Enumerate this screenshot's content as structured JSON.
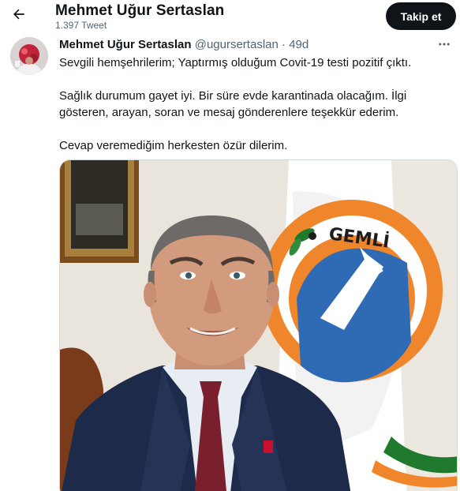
{
  "header": {
    "title": "Mehmet Uğur Sertaslan",
    "tweet_count": "1.397 Tweet",
    "follow_label": "Takip et",
    "back_icon": "arrow-left-icon"
  },
  "tweet": {
    "author_name": "Mehmet Uğur Sertaslan",
    "author_handle": "@ugursertaslan",
    "separator": "·",
    "time": "49d",
    "more_icon": "more-horizontal-icon",
    "paragraphs": [
      "Sevgili hemşehrilerim; Yaptırmış olduğum Covit-19 testi pozitif çıktı.",
      "Sağlık durumum gayet iyi. Bir süre evde karantinada olacağım. İlgi gösteren, arayan, soran ve mesaj gönderenlere teşekkür ederim.",
      "Cevap veremediğim herkesten özür dilerim."
    ],
    "media": {
      "logo_text": "GEMLİ"
    }
  },
  "colors": {
    "text": "#0f1419",
    "secondary": "#536471",
    "button_bg": "#0f1419",
    "button_text": "#ffffff"
  }
}
